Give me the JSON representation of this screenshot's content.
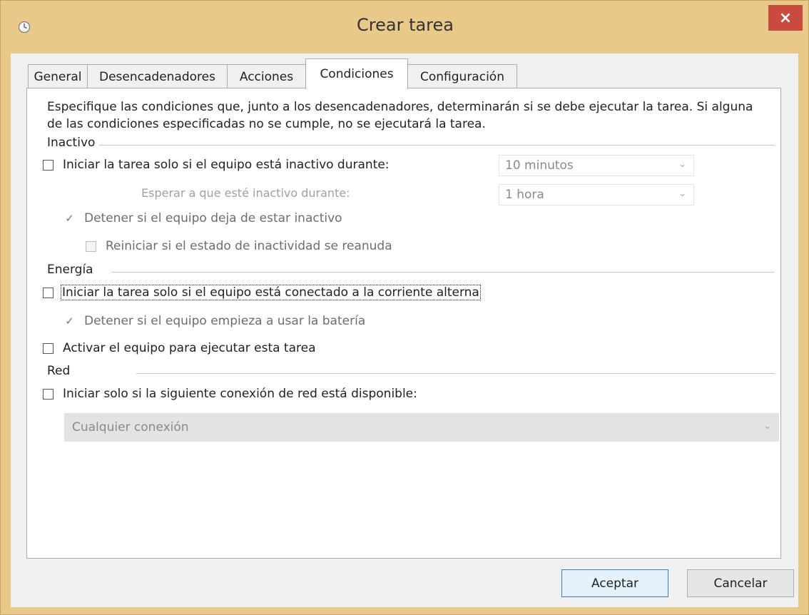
{
  "window": {
    "title": "Crear tarea",
    "icon": "clock-icon",
    "close_glyph": "×"
  },
  "tabs": [
    {
      "label": "General",
      "active": false
    },
    {
      "label": "Desencadenadores",
      "active": false
    },
    {
      "label": "Acciones",
      "active": false
    },
    {
      "label": "Condiciones",
      "active": true
    },
    {
      "label": "Configuración",
      "active": false
    }
  ],
  "description": "Especifique las condiciones que, junto a los desencadenadores, determinarán si se debe ejecutar la tarea. Si alguna de las condiciones especificadas no se cumple, no se ejecutará la tarea.",
  "inactivo": {
    "label": "Inactivo",
    "start_if_idle": {
      "label": "Iniciar la tarea solo si el equipo está inactivo durante:",
      "checked": false,
      "enabled": true
    },
    "idle_duration": {
      "value": "10 minutos",
      "enabled": false
    },
    "wait_label": "Esperar a que esté inactivo durante:",
    "wait_duration": {
      "value": "1 hora",
      "enabled": false
    },
    "stop_if_not_idle": {
      "label": "Detener si el equipo deja de estar inactivo",
      "checked": true,
      "enabled": false
    },
    "restart_if_idle": {
      "label": "Reiniciar si el estado de inactividad se reanuda",
      "checked": false,
      "enabled": false
    }
  },
  "energia": {
    "label": "Energía",
    "start_on_ac": {
      "label": "Iniciar la tarea solo si el equipo está conectado a la corriente alterna",
      "checked": false,
      "enabled": true
    },
    "stop_on_battery": {
      "label": "Detener si el equipo empieza a usar la batería",
      "checked": true,
      "enabled": false
    },
    "wake_to_run": {
      "label": "Activar el equipo para ejecutar esta tarea",
      "checked": false,
      "enabled": true
    }
  },
  "red": {
    "label": "Red",
    "start_if_network": {
      "label": "Iniciar solo si la siguiente conexión de red está disponible:",
      "checked": false,
      "enabled": true
    },
    "network_select": {
      "value": "Cualquier conexión",
      "enabled": false
    }
  },
  "buttons": {
    "ok": "Aceptar",
    "cancel": "Cancelar"
  },
  "colors": {
    "title_bar": "#e9c989",
    "close_button": "#c94a3f",
    "dialog_bg": "#f0f0f0",
    "panel_bg": "#ffffff"
  }
}
